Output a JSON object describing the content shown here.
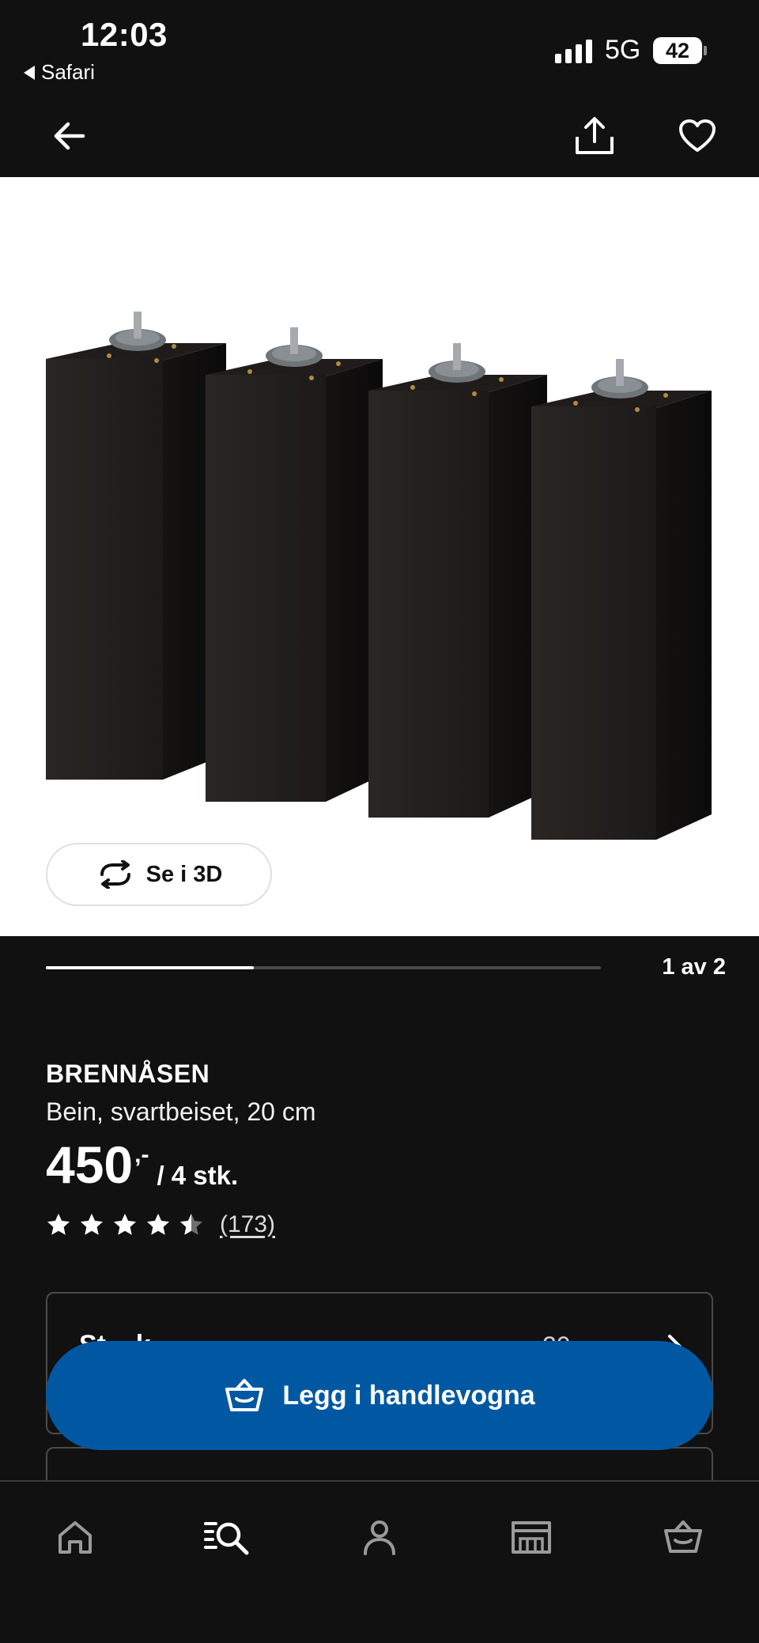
{
  "status_bar": {
    "time": "12:03",
    "back_app": "Safari",
    "network": "5G",
    "battery": "42"
  },
  "nav": {
    "back_icon": "arrow-left-icon",
    "share_icon": "share-icon",
    "favorite_icon": "heart-icon"
  },
  "gallery": {
    "view_3d_label": "Se i 3D",
    "page_indicator": "1 av 2",
    "progress_fraction": 0.375
  },
  "product": {
    "name": "BRENNÅSEN",
    "description": "Bein, svartbeiset, 20 cm",
    "price": "450",
    "price_suffix": ",-",
    "price_unit": "/ 4 stk.",
    "rating": 4.5,
    "review_count": "(173)"
  },
  "stock": {
    "label": "St... k",
    "value": "20"
  },
  "cart": {
    "add_label": "Legg i handlevogna"
  },
  "tabbar": {
    "items": [
      "home-icon",
      "search-icon",
      "profile-icon",
      "store-icon",
      "cart-icon"
    ]
  },
  "colors": {
    "background": "#111111",
    "primary_button": "#0058a3",
    "image_background": "#ffffff"
  }
}
